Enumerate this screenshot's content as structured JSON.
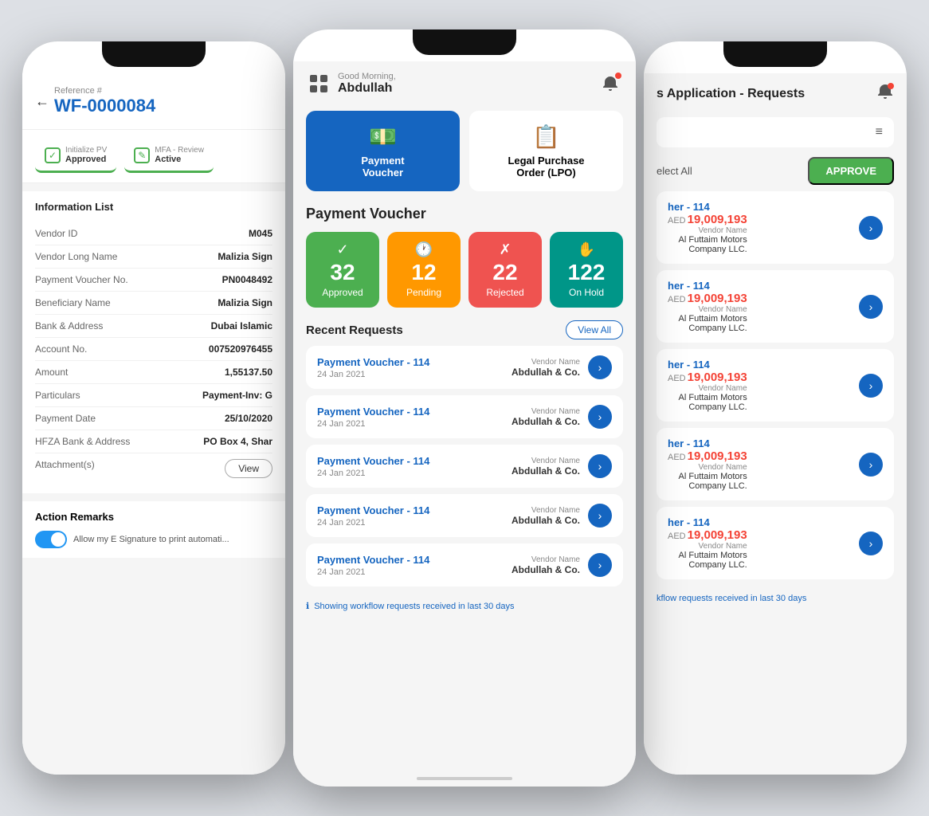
{
  "left": {
    "ref_label": "Reference #",
    "ref_number": "WF-0000084",
    "tab1_sublabel": "Initialize PV",
    "tab1_mainlabel": "Approved",
    "tab2_sublabel": "MFA - Review",
    "tab2_mainlabel": "Active",
    "info_title": "Information List",
    "fields": [
      {
        "key": "Vendor ID",
        "val": "M045"
      },
      {
        "key": "Vendor Long Name",
        "val": "Malizia Sign"
      },
      {
        "key": "Payment Voucher No.",
        "val": "PN0048492"
      },
      {
        "key": "Beneficiary Name",
        "val": "Malizia Sign"
      },
      {
        "key": "Bank & Address",
        "val": "Dubai Islamic"
      },
      {
        "key": "Account No.",
        "val": "007520976455"
      },
      {
        "key": "Amount",
        "val": "1,55137.50"
      },
      {
        "key": "Particulars",
        "val": "Payment-Inv: G"
      },
      {
        "key": "Payment Date",
        "val": "25/10/2020"
      },
      {
        "key": "HFZA Bank & Address",
        "val": "PO Box 4, Shar"
      },
      {
        "key": "Attachment(s)",
        "val": ""
      }
    ],
    "view_btn": "View",
    "action_title": "Action Remarks",
    "toggle_label": "Allow my E Signature to print automati..."
  },
  "center": {
    "greeting_sub": "Good Morning,",
    "greeting_name": "Abdullah",
    "module1_label": "Payment\nVoucher",
    "module2_label": "Legal Purchase\nOrder (LPO)",
    "section_title": "Payment Voucher",
    "stats": [
      {
        "number": "32",
        "label": "Approved",
        "color": "green",
        "icon": "✓"
      },
      {
        "number": "12",
        "label": "Pending",
        "color": "orange",
        "icon": "🕐"
      },
      {
        "number": "22",
        "label": "Rejected",
        "color": "red",
        "icon": "✗"
      },
      {
        "number": "122",
        "label": "On Hold",
        "color": "teal",
        "icon": "✋"
      }
    ],
    "recent_title": "Recent Requests",
    "view_all": "View All",
    "requests": [
      {
        "name": "Payment Voucher - 114",
        "date": "24 Jan 2021",
        "vendor_label": "Vendor Name",
        "vendor": "Abdullah & Co."
      },
      {
        "name": "Payment Voucher - 114",
        "date": "24 Jan 2021",
        "vendor_label": "Vendor Name",
        "vendor": "Abdullah & Co."
      },
      {
        "name": "Payment Voucher - 114",
        "date": "24 Jan 2021",
        "vendor_label": "Vendor Name",
        "vendor": "Abdullah & Co."
      },
      {
        "name": "Payment Voucher - 114",
        "date": "24 Jan 2021",
        "vendor_label": "Vendor Name",
        "vendor": "Abdullah & Co."
      },
      {
        "name": "Payment Voucher - 114",
        "date": "24 Jan 2021",
        "vendor_label": "Vendor Name",
        "vendor": "Abdullah & Co."
      }
    ],
    "footer": "Showing workflow requests received in last 30 days"
  },
  "right": {
    "title": "s Application - Requests",
    "select_all": "elect All",
    "approve_btn": "APPROVE",
    "items": [
      {
        "name": "her - 114",
        "aed": "AED",
        "amount": "19,009,193",
        "vendor_label": "Vendor Name",
        "vendor": "Al Futtaim Motors\nCompany LLC."
      },
      {
        "name": "her - 114",
        "aed": "AED",
        "amount": "19,009,193",
        "vendor_label": "Vendor Name",
        "vendor": "Al Futtaim Motors\nCompany LLC."
      },
      {
        "name": "her - 114",
        "aed": "AED",
        "amount": "19,009,193",
        "vendor_label": "Vendor Name",
        "vendor": "Al Futtaim Motors\nCompany LLC."
      },
      {
        "name": "her - 114",
        "aed": "AED",
        "amount": "19,009,193",
        "vendor_label": "Vendor Name",
        "vendor": "Al Futtaim Motors\nCompany LLC."
      },
      {
        "name": "her - 114",
        "aed": "AED",
        "amount": "19,009,193",
        "vendor_label": "Vendor Name",
        "vendor": "Al Futtaim Motors\nCompany LLC."
      }
    ],
    "footer": "kflow requests received in last 30 days"
  }
}
